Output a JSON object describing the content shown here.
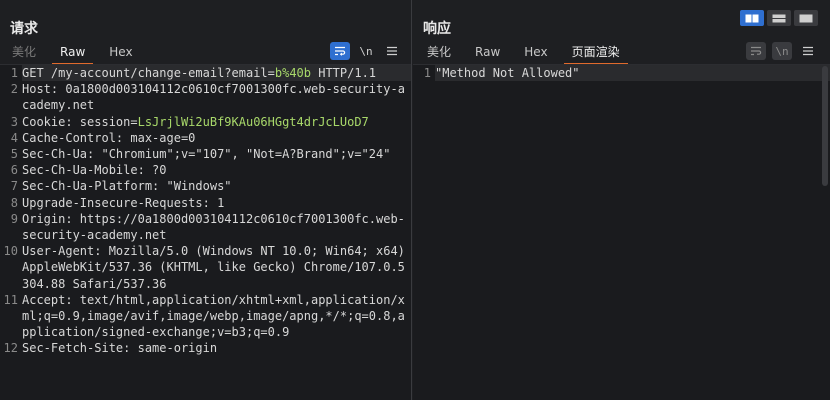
{
  "request": {
    "title": "请求",
    "tabs": [
      "美化",
      "Raw",
      "Hex"
    ],
    "active_tab": "Raw",
    "tools": {
      "wrap_icon": "wrap-lines-icon",
      "newline_label": "\\n",
      "menu_icon": "hamburger-menu-icon"
    },
    "lines": [
      {
        "n": "1",
        "parts": [
          {
            "t": "GET /my-account/change-email?email=",
            "c": "k"
          },
          {
            "t": "b%40b",
            "c": "v-ok"
          },
          {
            "t": " HTTP/1.1",
            "c": "k"
          }
        ]
      },
      {
        "n": "2",
        "parts": [
          {
            "t": "Host: ",
            "c": "k"
          },
          {
            "t": "0a1800d003104112c0610cf7001300fc.web-security-academy.net",
            "c": "v-str"
          }
        ]
      },
      {
        "n": "3",
        "parts": [
          {
            "t": "Cookie: session=",
            "c": "k"
          },
          {
            "t": "LsJrjlWi2uBf9KAu06HGgt4drJcLUoD7",
            "c": "v-ok"
          }
        ]
      },
      {
        "n": "4",
        "parts": [
          {
            "t": "Cache-Control: max-age=0",
            "c": "k"
          }
        ]
      },
      {
        "n": "5",
        "parts": [
          {
            "t": "Sec-Ch-Ua: \"Chromium\";v=\"107\", \"Not=A?Brand\";v=\"24\"",
            "c": "k"
          }
        ]
      },
      {
        "n": "6",
        "parts": [
          {
            "t": "Sec-Ch-Ua-Mobile: ?0",
            "c": "k"
          }
        ]
      },
      {
        "n": "7",
        "parts": [
          {
            "t": "Sec-Ch-Ua-Platform: \"Windows\"",
            "c": "k"
          }
        ]
      },
      {
        "n": "8",
        "parts": [
          {
            "t": "Upgrade-Insecure-Requests: 1",
            "c": "k"
          }
        ]
      },
      {
        "n": "9",
        "parts": [
          {
            "t": "Origin: ",
            "c": "k"
          },
          {
            "t": "https://0a1800d003104112c0610cf7001300fc.web-security-academy.net",
            "c": "v-str"
          }
        ]
      },
      {
        "n": "10",
        "parts": [
          {
            "t": "User-Agent: Mozilla/5.0 (Windows NT 10.0; Win64; x64) AppleWebKit/537.36 (KHTML, like Gecko) Chrome/107.0.5304.88 Safari/537.36",
            "c": "k"
          }
        ]
      },
      {
        "n": "11",
        "parts": [
          {
            "t": "Accept: ",
            "c": "k"
          },
          {
            "t": "text/html,application/xhtml+xml,application/xml;q=0.9,image/avif,image/webp,image/apng,*/*;q=0.8,application/signed-exchange;v=b3;q=0.9",
            "c": "v-str"
          }
        ]
      },
      {
        "n": "12",
        "parts": [
          {
            "t": "Sec-Fetch-Site: same-origin",
            "c": "k"
          }
        ]
      }
    ]
  },
  "response": {
    "title": "响应",
    "tabs": [
      "美化",
      "Raw",
      "Hex",
      "页面渲染"
    ],
    "active_tab": "页面渲染",
    "tools": {
      "wrap_icon": "wrap-lines-icon",
      "newline_label": "\\n",
      "menu_icon": "hamburger-menu-icon"
    },
    "lines": [
      {
        "n": "1",
        "parts": [
          {
            "t": "\"Method Not Allowed\"",
            "c": "k"
          }
        ]
      }
    ]
  },
  "layout_switch": {
    "options": [
      "side-by-side-layout-icon",
      "stacked-layout-icon",
      "single-pane-layout-icon"
    ],
    "active": "side-by-side-layout-icon"
  },
  "colors": {
    "accent": "#e06a2c",
    "button_active": "#2f6fd0",
    "highlight_value": "#a8d86a",
    "background": "#1e1f22"
  }
}
